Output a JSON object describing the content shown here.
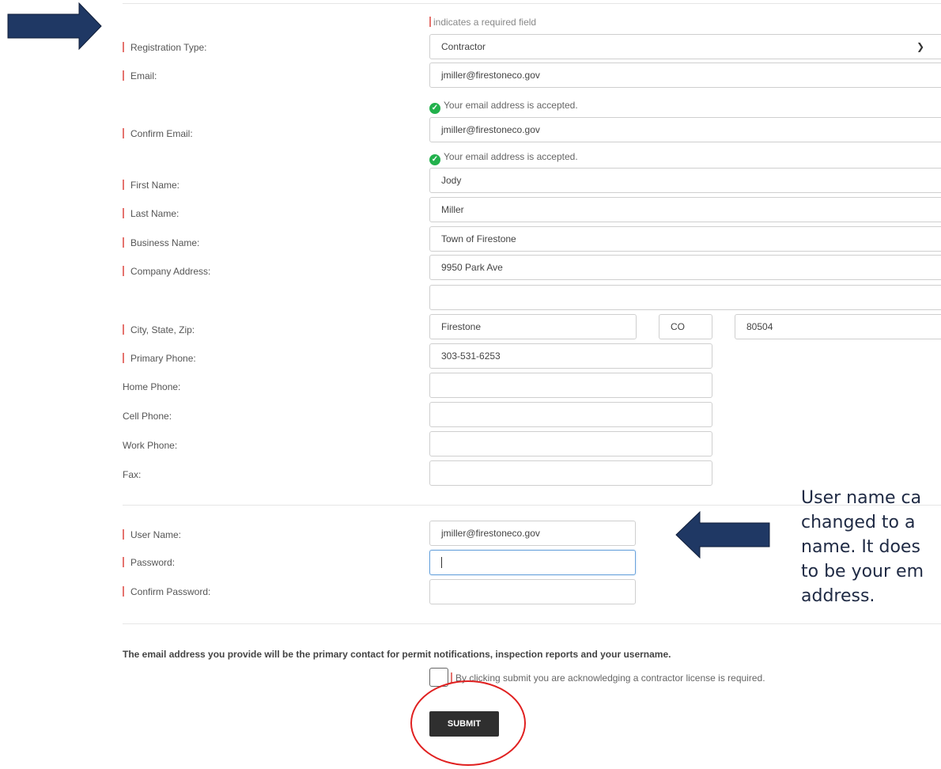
{
  "required_note": "indicates a required field",
  "fields": {
    "registration_type": {
      "label": "Registration Type:",
      "value": "Contractor"
    },
    "email": {
      "label": "Email:",
      "value": "jmiller@firestoneco.gov"
    },
    "email_status": "Your email address is accepted.",
    "confirm_email": {
      "label": "Confirm Email:",
      "value": "jmiller@firestoneco.gov"
    },
    "confirm_email_status": "Your email address is accepted.",
    "first_name": {
      "label": "First Name:",
      "value": "Jody"
    },
    "last_name": {
      "label": "Last Name:",
      "value": "Miller"
    },
    "business_name": {
      "label": "Business Name:",
      "value": "Town of Firestone"
    },
    "company_address": {
      "label": "Company Address:",
      "value": "9950 Park Ave",
      "value2": ""
    },
    "city_state_zip": {
      "label": "City, State, Zip:",
      "city": "Firestone",
      "state": "CO",
      "zip": "80504"
    },
    "primary_phone": {
      "label": "Primary Phone:",
      "value": "303-531-6253"
    },
    "home_phone": {
      "label": "Home Phone:",
      "value": ""
    },
    "cell_phone": {
      "label": "Cell Phone:",
      "value": ""
    },
    "work_phone": {
      "label": "Work Phone:",
      "value": ""
    },
    "fax": {
      "label": "Fax:",
      "value": ""
    },
    "user_name": {
      "label": "User Name:",
      "value": "jmiller@firestoneco.gov"
    },
    "password": {
      "label": "Password:",
      "value": ""
    },
    "confirm_password": {
      "label": "Confirm Password:",
      "value": ""
    }
  },
  "primary_contact_note": "The email address you provide will be the primary contact for permit notifications, inspection reports and your username.",
  "acknowledge_text": "By clicking submit you are acknowledging a contractor license is required.",
  "submit_label": "SUBMIT",
  "annotation": {
    "lines": [
      "User name ca",
      "changed to a",
      "name. It does",
      "to be your em",
      "address."
    ]
  },
  "colors": {
    "required_marker": "#e5736e",
    "accepted_check": "#22b14c",
    "arrow": "#1f3864",
    "highlight_circle": "#e02020",
    "submit_bg": "#2f2f2f"
  },
  "icons": {
    "check": "check-circle-icon",
    "select": "chevron-down-icon",
    "arrow": "arrow-right-icon"
  }
}
